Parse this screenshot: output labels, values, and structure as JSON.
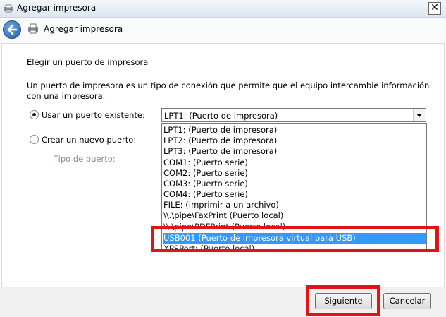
{
  "window": {
    "title": "Agregar impresora",
    "close_glyph": "✕"
  },
  "nav": {
    "title": "Agregar impresora"
  },
  "content": {
    "heading": "Elegir un puerto de impresora",
    "description": "Un puerto de impresora es un tipo de conexión que permite que el equipo intercambie información con una impresora.",
    "existing_port_label": "Usar un puerto existente:",
    "new_port_label": "Crear un nuevo puerto:",
    "port_type_label": "Tipo de puerto:",
    "selected_port": "LPT1: (Puerto de impresora)",
    "port_options": [
      "LPT1: (Puerto de impresora)",
      "LPT2: (Puerto de impresora)",
      "LPT3: (Puerto de impresora)",
      "COM1: (Puerto serie)",
      "COM2: (Puerto serie)",
      "COM3: (Puerto serie)",
      "COM4: (Puerto serie)",
      "FILE: (Imprimir a un archivo)",
      "\\\\.\\pipe\\FaxPrint (Puerto local)",
      "\\\\.\\pipe\\PDFPrint (Puerto local)",
      "USB001 (Puerto de impresora virtual para USB)",
      "XPSPort: (Puerto local)"
    ]
  },
  "buttons": {
    "next": "Siguiente",
    "cancel": "Cancelar"
  },
  "colors": {
    "highlight": "#3399ff",
    "annotation": "#e11414"
  }
}
